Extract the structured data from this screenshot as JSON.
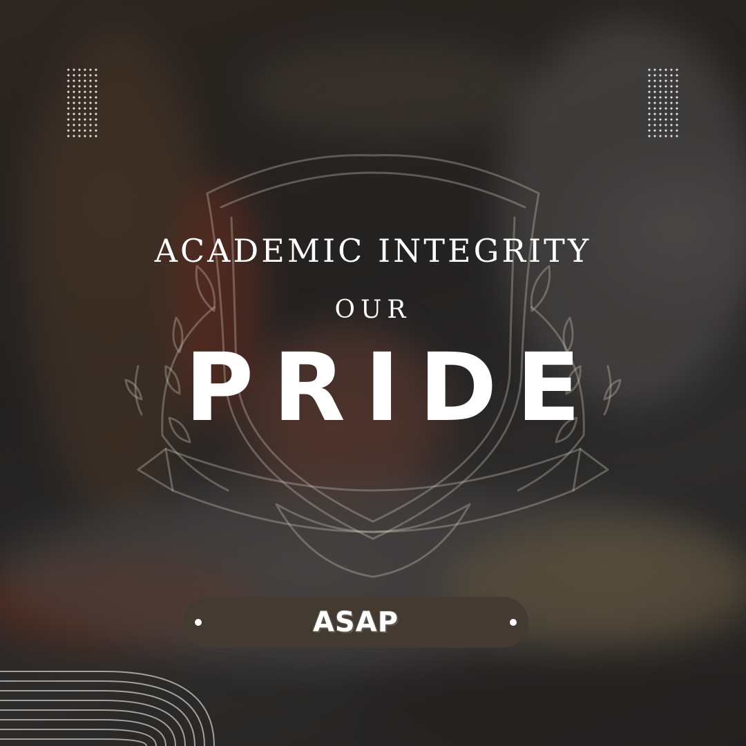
{
  "poster": {
    "title_line1": "ACADEMIC INTEGRITY",
    "title_line2": "OUR",
    "title_line3": "PRIDE",
    "badge_label": "ASAP"
  },
  "colors": {
    "text": "#ffffff",
    "badge_background": "#433a31",
    "crest_outline": "#c9c2b8"
  },
  "decorations": {
    "top_left": "dot-grid",
    "top_right": "dot-grid",
    "center": "crest-shield-with-laurel-and-ribbon",
    "bottom_left": "concentric-arc-lines"
  }
}
